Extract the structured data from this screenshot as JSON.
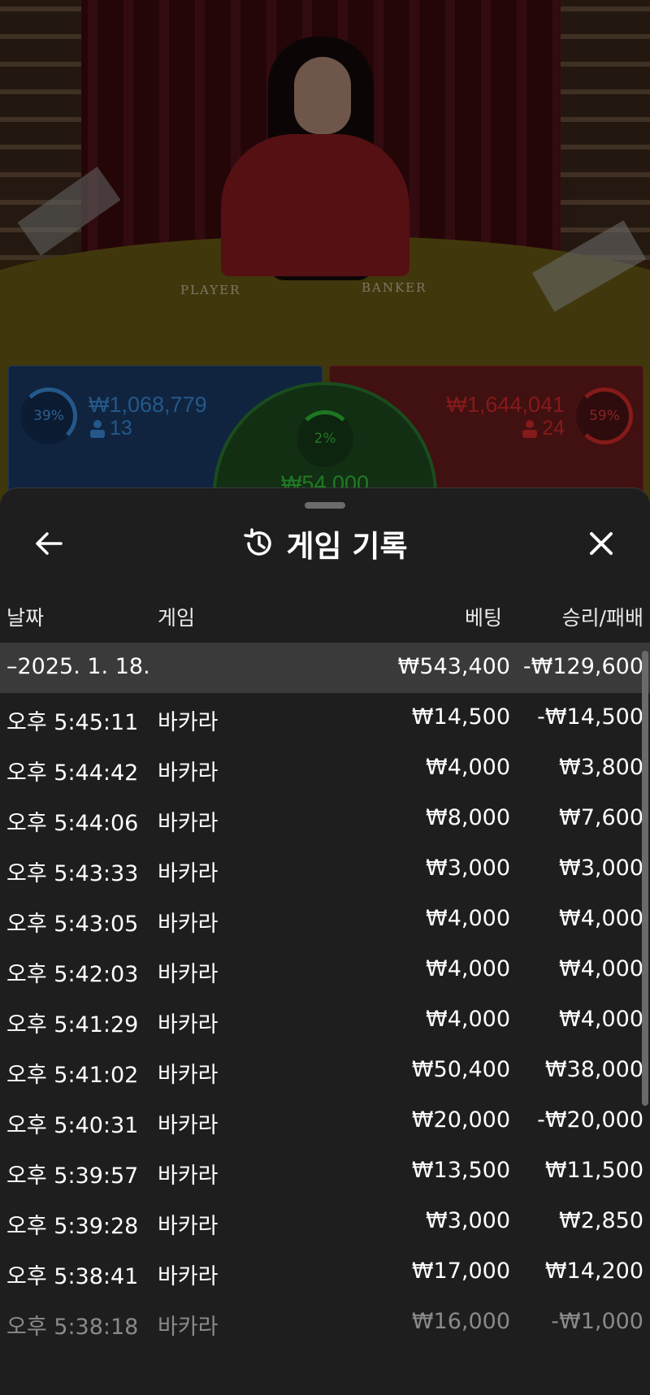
{
  "video": {
    "player_label": "PLAYER",
    "banker_label": "BANKER",
    "player": {
      "percent": "39%",
      "amount": "₩1,068,779",
      "count": "13"
    },
    "banker": {
      "percent": "59%",
      "amount": "₩1,644,041",
      "count": "24"
    },
    "tie": {
      "percent": "2%",
      "amount": "₩54,000"
    },
    "colors": {
      "player": "#3b8fe0",
      "banker": "#d52b2b",
      "tie": "#35c23e"
    }
  },
  "history": {
    "title": "게임 기록",
    "icons": {
      "back": "arrow-left-icon",
      "title": "history-icon",
      "close": "close-icon"
    },
    "columns": {
      "date": "날짜",
      "game": "게임",
      "bet": "베팅",
      "result": "승리/패배"
    },
    "summary": {
      "date": "–2025. 1. 18.",
      "bet": "₩543,400",
      "result": "-₩129,600"
    },
    "rows": [
      {
        "time": "오후 5:45:11",
        "game": "바카라",
        "bet": "₩14,500",
        "result": "-₩14,500"
      },
      {
        "time": "오후 5:44:42",
        "game": "바카라",
        "bet": "₩4,000",
        "result": "₩3,800"
      },
      {
        "time": "오후 5:44:06",
        "game": "바카라",
        "bet": "₩8,000",
        "result": "₩7,600"
      },
      {
        "time": "오후 5:43:33",
        "game": "바카라",
        "bet": "₩3,000",
        "result": "₩3,000"
      },
      {
        "time": "오후 5:43:05",
        "game": "바카라",
        "bet": "₩4,000",
        "result": "₩4,000"
      },
      {
        "time": "오후 5:42:03",
        "game": "바카라",
        "bet": "₩4,000",
        "result": "₩4,000"
      },
      {
        "time": "오후 5:41:29",
        "game": "바카라",
        "bet": "₩4,000",
        "result": "₩4,000"
      },
      {
        "time": "오후 5:41:02",
        "game": "바카라",
        "bet": "₩50,400",
        "result": "₩38,000"
      },
      {
        "time": "오후 5:40:31",
        "game": "바카라",
        "bet": "₩20,000",
        "result": "-₩20,000"
      },
      {
        "time": "오후 5:39:57",
        "game": "바카라",
        "bet": "₩13,500",
        "result": "₩11,500"
      },
      {
        "time": "오후 5:39:28",
        "game": "바카라",
        "bet": "₩3,000",
        "result": "₩2,850"
      },
      {
        "time": "오후 5:38:41",
        "game": "바카라",
        "bet": "₩17,000",
        "result": "₩14,200"
      },
      {
        "time": "오후 5:38:18",
        "game": "바카라",
        "bet": "₩16,000",
        "result": "-₩1,000"
      }
    ]
  }
}
